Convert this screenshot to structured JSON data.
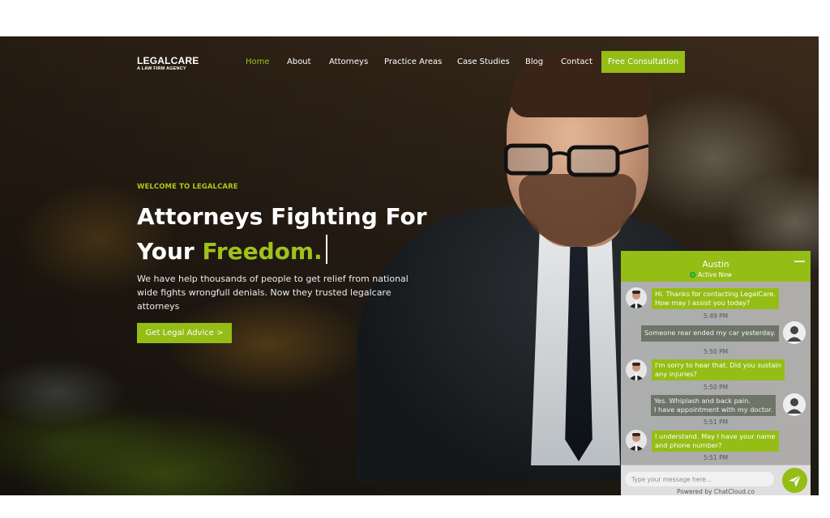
{
  "brand": {
    "name": "LEGALCARE",
    "tagline": "A LAW FIRM AGENCY"
  },
  "nav": {
    "items": [
      {
        "label": "Home",
        "active": true
      },
      {
        "label": "About"
      },
      {
        "label": "Attorneys"
      },
      {
        "label": "Practice Areas"
      },
      {
        "label": "Case Studies"
      },
      {
        "label": "Blog"
      },
      {
        "label": "Contact"
      }
    ],
    "cta_label": "Free Consultation"
  },
  "hero": {
    "eyebrow": "WELCOME TO LEGALCARE",
    "headline_line1": "Attorneys Fighting For",
    "headline_line2_prefix": "Your",
    "headline_line2_highlight": "Freedom.",
    "description": "We have help thousands of people to get relief from national wide fights wrongfull denials. Now they trusted legalcare attorneys",
    "button_label": "Get Legal Advice >"
  },
  "chat": {
    "agent_name": "Austin",
    "status": "Active Now",
    "messages": [
      {
        "from": "agent",
        "lines": [
          "Hi. Thanks for contacting LegalCare.",
          "How may I assist you today?"
        ],
        "time": "5:49 PM"
      },
      {
        "from": "user",
        "lines": [
          "Someone rear ended my car yesterday."
        ],
        "time": "5:50 PM"
      },
      {
        "from": "agent",
        "lines": [
          "I'm sorry to hear that. Did you sustain",
          "any injuries?"
        ],
        "time": "5:50 PM"
      },
      {
        "from": "user",
        "lines": [
          "Yes. Whiplash and back pain.",
          "I have appointment with my doctor."
        ],
        "time": "5:51 PM"
      },
      {
        "from": "agent",
        "lines": [
          "I understand. May I have your name",
          "and phone number?"
        ],
        "time": "5:51 PM"
      }
    ],
    "input_placeholder": "Type your message here...",
    "powered_by": "Powered by ChatCloud.co"
  },
  "colors": {
    "accent": "#94bd16",
    "accent_text": "#9fc21c"
  },
  "icons": {
    "send": "send-icon",
    "agent_avatar": "agent-avatar",
    "user_avatar": "user-avatar-icon"
  }
}
